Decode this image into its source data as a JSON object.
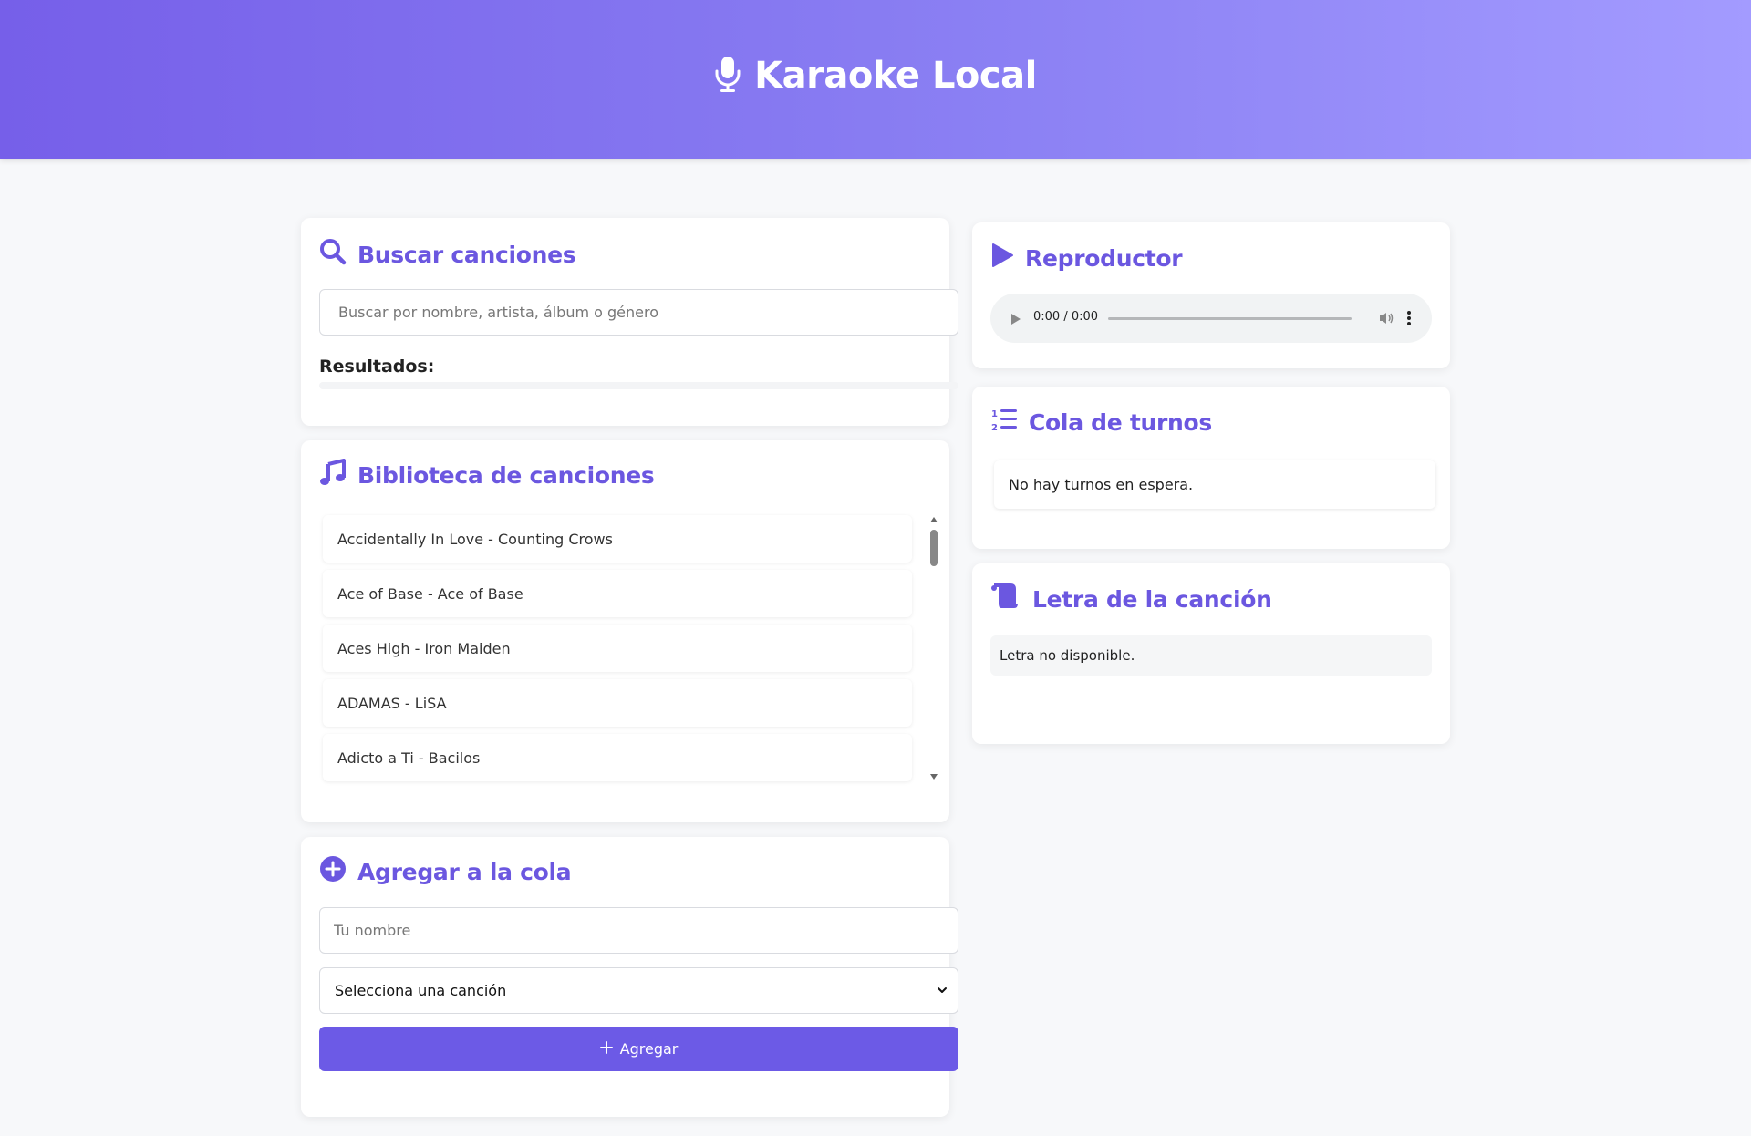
{
  "header": {
    "title": "Karaoke Local",
    "icon": "microphone-icon"
  },
  "search": {
    "title": "Buscar canciones",
    "placeholder": "Buscar por nombre, artista, álbum o género",
    "results_label": "Resultados:"
  },
  "library": {
    "title": "Biblioteca de canciones",
    "songs": [
      "Accidentally In Love - Counting Crows",
      "Ace of Base - Ace of Base",
      "Aces High - Iron Maiden",
      "ADAMAS - LiSA",
      "Adicto a Ti - Bacilos"
    ]
  },
  "add_queue": {
    "title": "Agregar a la cola",
    "name_placeholder": "Tu nombre",
    "select_value": "Selecciona una canción",
    "button_label": "Agregar"
  },
  "player": {
    "title": "Reproductor",
    "time": "0:00 / 0:00"
  },
  "queue": {
    "title": "Cola de turnos",
    "empty_text": "No hay turnos en espera."
  },
  "lyrics": {
    "title": "Letra de la canción",
    "text": "Letra no disponible."
  },
  "colors": {
    "accent": "#6c5ae6",
    "header_start": "#765fe9",
    "header_end": "#a39bff"
  }
}
